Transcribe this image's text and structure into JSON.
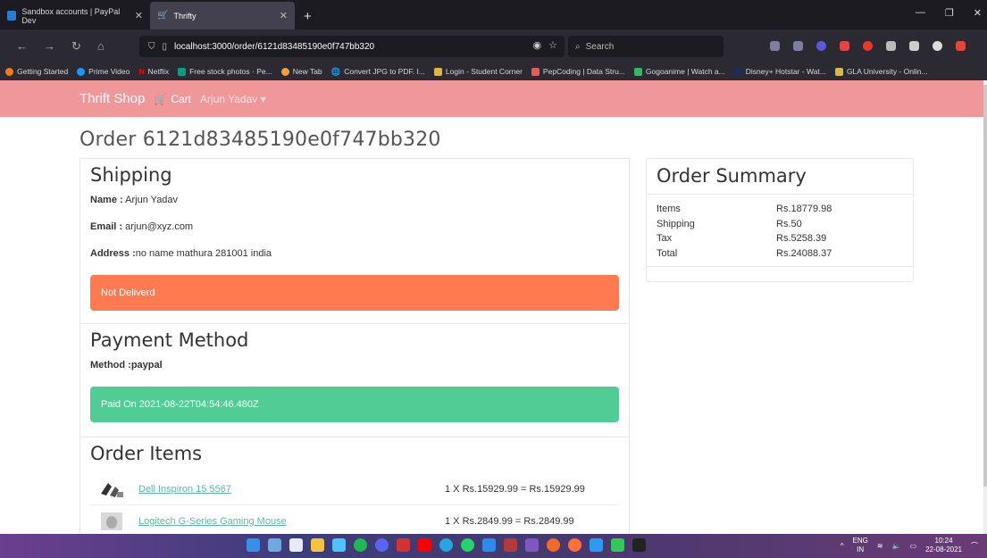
{
  "browser": {
    "tabs": [
      {
        "label": "Sandbox accounts | PayPal Dev",
        "active": false
      },
      {
        "label": "Thrifty",
        "active": true
      }
    ],
    "url": "localhost:3000/order/6121d83485190e0f747bb320",
    "search_placeholder": "Search",
    "bookmarks": [
      "Getting Started",
      "Prime Video",
      "Netflix",
      "Free stock photos · Pe...",
      "New Tab",
      "Convert JPG to PDF. I...",
      "Login - Student Corner",
      "PepCoding | Data Stru...",
      "Gogoanime | Watch a...",
      "Disney+ Hotstar - Wat...",
      "GLA University - Onlin..."
    ]
  },
  "app": {
    "brand": "Thrift Shop",
    "cart_label": "Cart",
    "user_label": "Arjun Yadav"
  },
  "order": {
    "title": "Order 6121d83485190e0f747bb320",
    "shipping": {
      "heading": "Shipping",
      "name_label": "Name :",
      "name": " Arjun Yadav",
      "email_label": "Email :",
      "email": " arjun@xyz.com",
      "address_label": "Address :",
      "address": "no name mathura 281001 india",
      "status": "Not Deliverd"
    },
    "payment": {
      "heading": "Payment Method",
      "method_label": "Method :",
      "method": "paypal",
      "status": "Paid On 2021-08-22T04:54:46.480Z"
    },
    "items": {
      "heading": "Order Items",
      "rows": [
        {
          "name": "Dell Inspiron 15 5567",
          "calc": "1 X Rs.15929.99 = Rs.15929.99"
        },
        {
          "name": "Logitech G-Series Gaming Mouse",
          "calc": "1 X Rs.2849.99 = Rs.2849.99"
        }
      ]
    }
  },
  "summary": {
    "heading": "Order Summary",
    "rows": [
      {
        "label": "Items",
        "value": "Rs.18779.98"
      },
      {
        "label": "Shipping",
        "value": "Rs.50"
      },
      {
        "label": "Tax",
        "value": "Rs.5258.39"
      },
      {
        "label": "Total",
        "value": "Rs.24088.37"
      }
    ]
  },
  "taskbar": {
    "lang": "ENG",
    "region": "IN",
    "time": "10:24",
    "date": "22-08-2021"
  },
  "colors": {
    "navbar": "#f0979a",
    "alert_danger": "#ff7a51",
    "alert_success": "#52cc95",
    "link": "#5cb8a5"
  }
}
